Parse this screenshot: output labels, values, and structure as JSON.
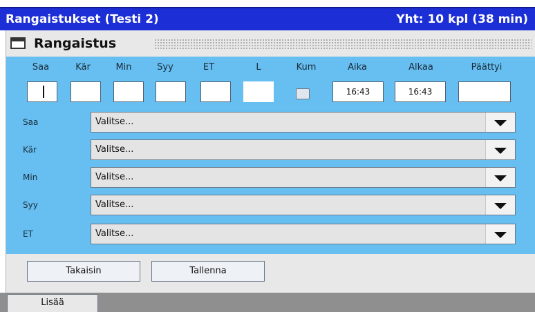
{
  "titlebar": {
    "left": "Rangaistukset (Testi 2)",
    "right": "Yht: 10 kpl (38 min)"
  },
  "dialog": {
    "title": "Rangaistus",
    "icon": "window-icon"
  },
  "fields": {
    "labels": [
      "Saa",
      "Kär",
      "Min",
      "Syy",
      "ET",
      "L",
      "Kum",
      "Aika",
      "Alkaa",
      "Päättyi"
    ],
    "values": {
      "saa": "",
      "kar": "",
      "min": "",
      "syy": "",
      "et": "",
      "l": "",
      "aika": "16:43",
      "alkaa": "16:43",
      "paattyi": ""
    }
  },
  "selects": [
    {
      "label": "Saa",
      "value": "Valitse..."
    },
    {
      "label": "Kär",
      "value": "Valitse..."
    },
    {
      "label": "Min",
      "value": "Valitse..."
    },
    {
      "label": "Syy",
      "value": "Valitse..."
    },
    {
      "label": "ET",
      "value": "Valitse..."
    }
  ],
  "buttons": {
    "back": "Takaisin",
    "save": "Tallenna"
  },
  "bottom_tab": {
    "label": "Lisää"
  },
  "colors": {
    "titlebar": "#1c2fd6",
    "form_background": "#66bff0",
    "panel": "#e8e8e8",
    "footer": "#8f8f8f"
  }
}
